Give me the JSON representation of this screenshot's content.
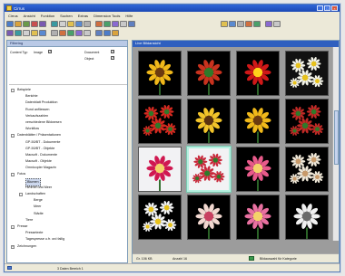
{
  "window": {
    "title": "Cirrus"
  },
  "menu": [
    "Cirrus",
    "Ansicht",
    "Funktion",
    "Suchen",
    "Extras",
    "Dimension Tools",
    "Hilfe"
  ],
  "toolbar_icons": [
    [
      "open-icon",
      "save-icon",
      "print-icon",
      "copy-icon",
      "paste-icon",
      "grid-icon",
      "list-icon",
      "table-icon",
      "image-icon",
      "search-icon",
      "filter-icon",
      "camera-icon",
      "photo-icon",
      "info-icon",
      "settings-icon"
    ],
    [
      "back-icon",
      "forward-icon",
      "up-icon",
      "refresh-icon",
      "delete-icon",
      "cut-icon",
      "rotate-icon",
      "export-icon",
      "folder-icon",
      "edit-icon",
      "print-icon",
      "zoom-icon",
      "home-icon"
    ]
  ],
  "toolbar_icons_right": [
    "globe-icon",
    "frame-icon",
    "grid-icon",
    "mail-icon",
    "info-icon",
    "tag-icon",
    "help-icon"
  ],
  "left_panel": {
    "header": "Filtering",
    "filters": {
      "content_type_label": "Content Typ",
      "image_label": "Image",
      "image_checked": true,
      "document_label": "Document",
      "document_checked": true,
      "object_label": "Object",
      "object_checked": true
    },
    "tree": [
      {
        "label": "Beispiele",
        "level": 0,
        "expander": "-"
      },
      {
        "label": "Berichte",
        "level": 1
      },
      {
        "label": "Datenblatt Produktion",
        "level": 1
      },
      {
        "label": "Rund anfliessen",
        "level": 1
      },
      {
        "label": "Verkaufszahlen",
        "level": 1
      },
      {
        "label": "verschiedene Bildwesen",
        "level": 1
      },
      {
        "label": "Workflow",
        "level": 1
      },
      {
        "label": "Datenblätter / Präsentationen",
        "level": 0,
        "expander": "-"
      },
      {
        "label": "GP-50/BT - Dokumente",
        "level": 1
      },
      {
        "label": "GP-50/BT - Objekte",
        "level": 1
      },
      {
        "label": "Macsoft - Dokumente",
        "level": 1
      },
      {
        "label": "Macsoft - Objekte",
        "level": 1
      },
      {
        "label": "Omnicopier Magazin",
        "level": 1
      },
      {
        "label": "Fotos",
        "level": 0,
        "expander": "-"
      },
      {
        "label": "Blumen",
        "level": 1,
        "selected": true
      },
      {
        "label": "Himmel und Meer",
        "level": 1
      },
      {
        "label": "Landschaften",
        "level": 1,
        "expander": "-"
      },
      {
        "label": "Berge",
        "level": 2
      },
      {
        "label": "Meer",
        "level": 2
      },
      {
        "label": "Städte",
        "level": 2
      },
      {
        "label": "Tiere",
        "level": 1
      },
      {
        "label": "Presse",
        "level": 0,
        "expander": "-"
      },
      {
        "label": "Pressetexte",
        "level": 1
      },
      {
        "label": "Tagespresse u.fr. ord fallig",
        "level": 1
      },
      {
        "label": "Zeichnungen",
        "level": 0,
        "expander": "+"
      }
    ]
  },
  "right_panel": {
    "header": "Live Bildansicht",
    "thumbnails": [
      {
        "subject": "sunflower-icon",
        "bg": "#000000",
        "petal": "#f0b81a",
        "center": "#6b3a10"
      },
      {
        "subject": "rose-icon",
        "bg": "#000000",
        "petal": "#c8321e",
        "center": "#2f7a2a"
      },
      {
        "subject": "red-flower-icon",
        "bg": "#000000",
        "petal": "#d01818",
        "center": "#ffd21a"
      },
      {
        "subject": "daisies-icon",
        "bg": "#111111",
        "petal": "#f4f4e8",
        "center": "#e8c21a"
      },
      {
        "subject": "tulips-icon",
        "bg": "#000000",
        "petal": "#d62a20",
        "center": "#2f7a2a"
      },
      {
        "subject": "sunflower-icon",
        "bg": "#000000",
        "petal": "#f2c42a",
        "center": "#5a3210"
      },
      {
        "subject": "sunflower-icon",
        "bg": "#000000",
        "petal": "#f0b81a",
        "center": "#6b3a10"
      },
      {
        "subject": "roses-icon",
        "bg": "#000000",
        "petal": "#c02a26",
        "center": "#2f7a2a"
      },
      {
        "subject": "hibiscus-icon",
        "bg": "#f2f2f4",
        "petal": "#d01850",
        "center": "#f4d26a"
      },
      {
        "subject": "red-bouquet-icon",
        "bg": "#f2f2f4",
        "petal": "#c8283a",
        "center": "#2f7a2a"
      },
      {
        "subject": "blossom-icon",
        "bg": "#000000",
        "petal": "#e85a8a",
        "center": "#f4d26a"
      },
      {
        "subject": "wreath-icon",
        "bg": "#000000",
        "petal": "#f0e8d8",
        "center": "#c89a6a"
      },
      {
        "subject": "white-flowers-icon",
        "bg": "#000000",
        "petal": "#f4f4f4",
        "center": "#e8c21a"
      },
      {
        "subject": "lily-icon",
        "bg": "#000000",
        "petal": "#f2d8d0",
        "center": "#c84060"
      },
      {
        "subject": "pink-flower-icon",
        "bg": "#000000",
        "petal": "#e870a0",
        "center": "#f4d26a"
      },
      {
        "subject": "dark-flower-icon",
        "bg": "#000000",
        "petal": "#f0f0f0",
        "center": "#6a6a6a"
      }
    ],
    "selected_index": 9,
    "status": {
      "size_text": "Gr. 106 KB",
      "count_text": "Anzahl 16",
      "info_text": "Bildauswahl für Kategorie"
    }
  },
  "status_bar": {
    "text": "3 Daten Bereich 1"
  }
}
